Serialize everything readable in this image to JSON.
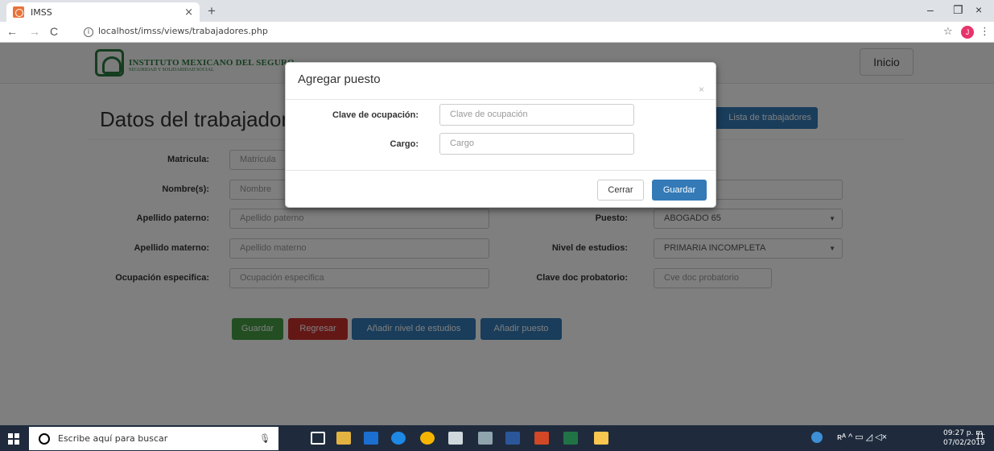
{
  "browser": {
    "tab_title": "IMSS",
    "tab_close": "×",
    "new_tab": "+",
    "url": "localhost/imss/views/trabajadores.php",
    "avatar_letter": "J",
    "window_controls": [
      "–",
      "❐",
      "×"
    ]
  },
  "navbar": {
    "brand_line1": "INSTITUTO MEXICANO DEL SEGURO",
    "brand_line2": "SEGURIDAD Y SOLIDARIDAD SOCIAL",
    "inicio": "Inicio"
  },
  "page": {
    "title": "Datos del trabajador",
    "lista_button": "Lista de trabajadores",
    "fields_left": [
      {
        "label": "Matricula:",
        "placeholder": "Matricula"
      },
      {
        "label": "Nombre(s):",
        "placeholder": "Nombre"
      },
      {
        "label": "Apellido paterno:",
        "placeholder": "Apellido paterno"
      },
      {
        "label": "Apellido materno:",
        "placeholder": "Apellido materno"
      },
      {
        "label": "Ocupación especifica:",
        "placeholder": "Ocupación especifica"
      }
    ],
    "fields_right": [
      {
        "label": "Puesto:",
        "value": "ABOGADO 65"
      },
      {
        "label": "Nivel de estudios:",
        "value": "PRIMARIA INCOMPLETA"
      },
      {
        "label": "Clave doc probatorio:",
        "placeholder": "Cve doc probatorio"
      }
    ],
    "buttons": {
      "guardar": "Guardar",
      "regresar": "Regresar",
      "nivel": "Añadir nivel de estudios",
      "puesto": "Añadir puesto"
    }
  },
  "modal": {
    "title": "Agregar puesto",
    "close": "×",
    "clave_label": "Clave de ocupación:",
    "clave_placeholder": "Clave de ocupación",
    "cargo_label": "Cargo:",
    "cargo_placeholder": "Cargo",
    "cerrar": "Cerrar",
    "guardar": "Guardar"
  },
  "taskbar": {
    "search_placeholder": "Escribe aquí para buscar",
    "time": "09:27 p. m.",
    "date": "07/02/2019",
    "notification_count": "11",
    "tray_text": "ʀᴬ ^ ▭ ◿ ◁×"
  },
  "colors": {
    "primary": "#337ab7",
    "success": "#449d44",
    "danger": "#c9302c",
    "imss_green": "#2b7a3f",
    "taskbar": "#1f2b3d"
  }
}
